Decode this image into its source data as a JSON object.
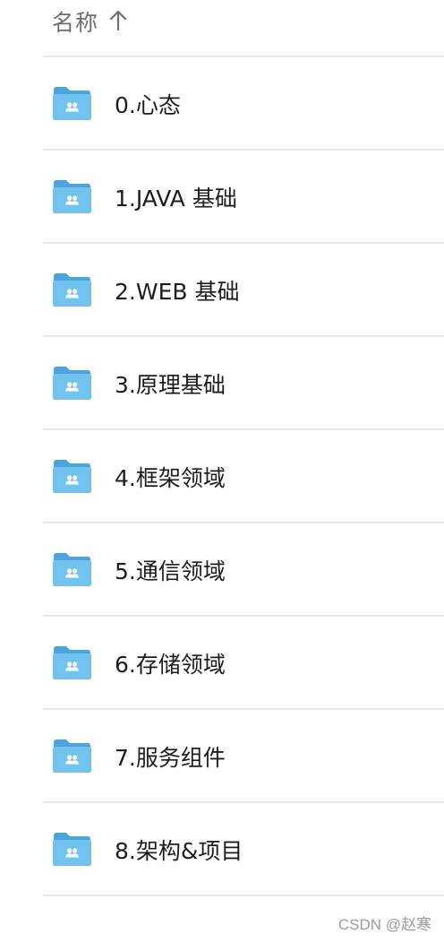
{
  "header": {
    "column_label": "名称",
    "sort_icon": "arrow-up-icon"
  },
  "folder_icon": "shared-folder-icon",
  "colors": {
    "folder_body": "#6fc3ee",
    "folder_tab": "#4fa3dc",
    "text": "#1d1d1f",
    "header_text": "#6e6e73",
    "divider": "#e6e6e6"
  },
  "items": [
    {
      "name": "0.心态"
    },
    {
      "name": "1.JAVA 基础"
    },
    {
      "name": "2.WEB 基础"
    },
    {
      "name": "3.原理基础"
    },
    {
      "name": "4.框架领域"
    },
    {
      "name": "5.通信领域"
    },
    {
      "name": "6.存储领域"
    },
    {
      "name": "7.服务组件"
    },
    {
      "name": "8.架构&项目"
    }
  ],
  "watermark": "CSDN @赵寒"
}
